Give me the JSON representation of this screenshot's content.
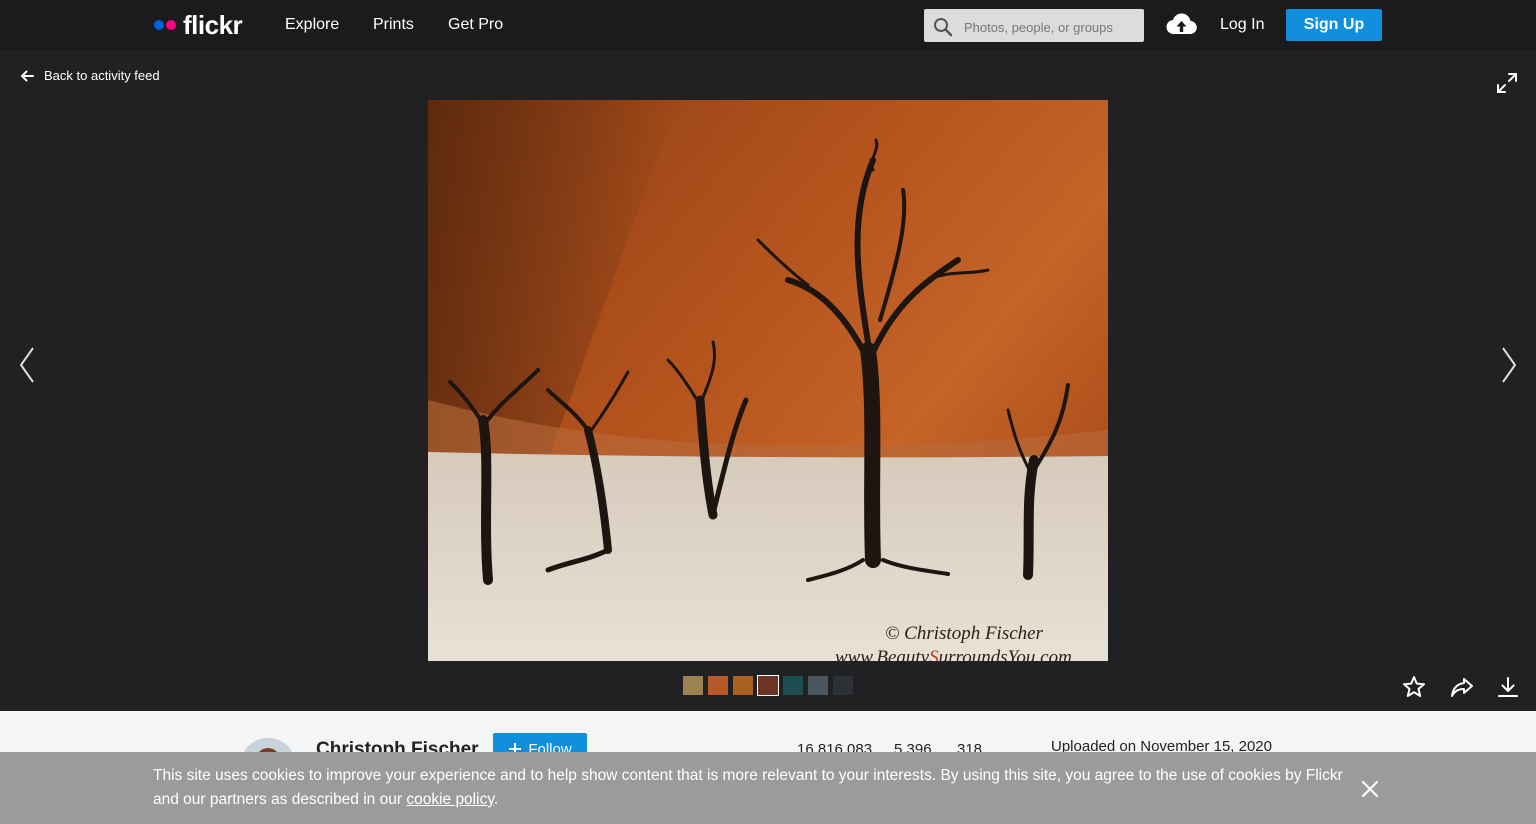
{
  "header": {
    "logo_text": "flickr",
    "nav": [
      "Explore",
      "Prints",
      "Get Pro"
    ],
    "search_placeholder": "Photos, people, or groups",
    "login_label": "Log In",
    "signup_label": "Sign Up"
  },
  "viewer": {
    "back_label": "Back to activity feed",
    "watermark_line1": "© Christoph Fischer",
    "watermark_line2_pre": "www.Beauty",
    "watermark_line2_s": "S",
    "watermark_line2_post": "urroundsYou.com",
    "filmstrip_colors": [
      "#9c8250",
      "#b5582a",
      "#a9611f",
      "#6b3524",
      "#1f4e52",
      "#4a5660",
      "#2c3135"
    ]
  },
  "info": {
    "owner_name": "Christoph Fischer",
    "follow_label": "Follow",
    "stats": [
      "16,816,083",
      "5,396",
      "318"
    ],
    "uploaded": "Uploaded on November 15, 2020"
  },
  "cookie": {
    "text": "This site uses cookies to improve your experience and to help show content that is more relevant to your interests. By using this site, you agree to the use of cookies by Flickr and our partners as described in our",
    "link": "cookie policy",
    "end": "."
  },
  "colors": {
    "header_bg": "#1b1b1d",
    "viewer_bg": "#212124",
    "accent_blue": "#128fdc",
    "logo_blue": "#0063dc",
    "logo_pink": "#ff0084",
    "cookie_bg": "#9b9b9c"
  }
}
